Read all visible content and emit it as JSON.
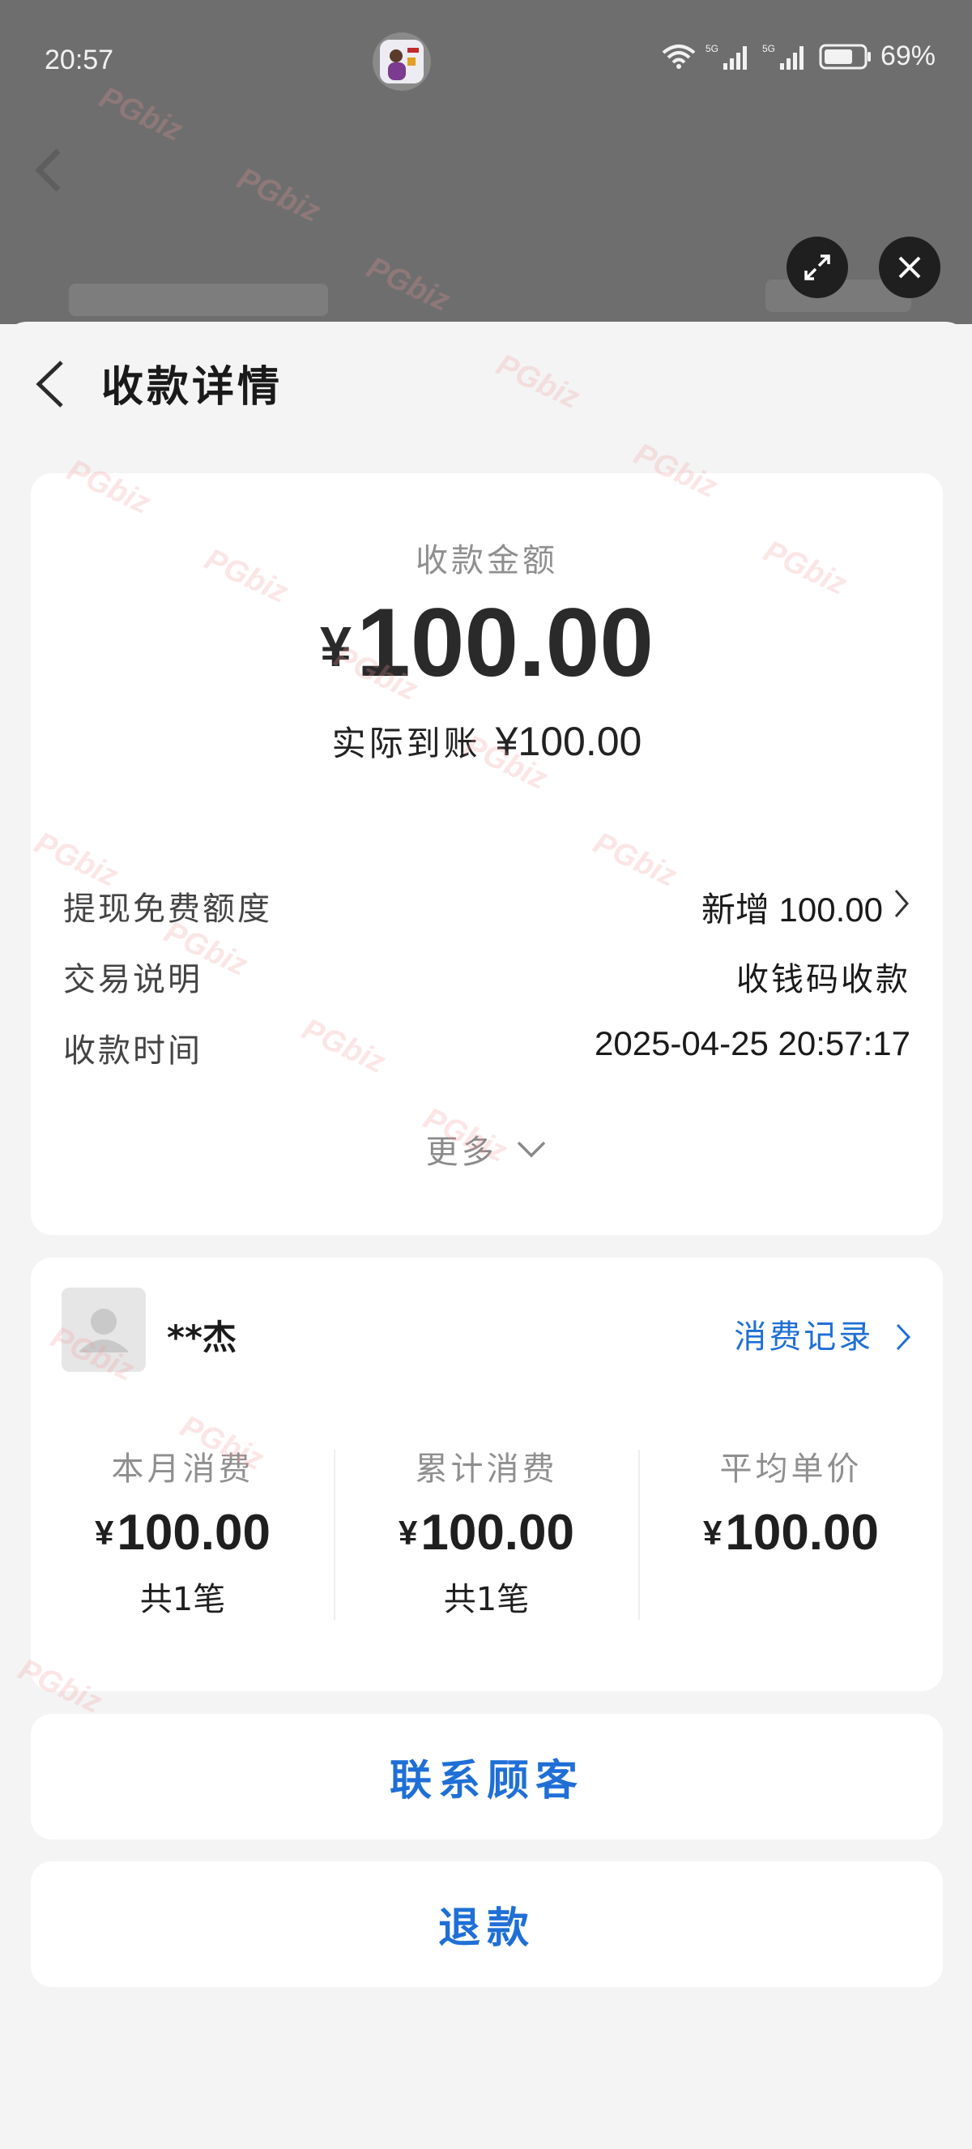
{
  "status": {
    "time": "20:57",
    "battery": "69%",
    "net1": "5G",
    "net2": "5G"
  },
  "header": {
    "title": "收款详情"
  },
  "payment": {
    "amount_label": "收款金额",
    "currency": "¥",
    "amount": "100.00",
    "actual_label": "实际到账",
    "actual_value": "¥100.00"
  },
  "details": [
    {
      "key": "提现免费额度",
      "value": "新增 100.00"
    },
    {
      "key": "交易说明",
      "value": "收钱码收款"
    },
    {
      "key": "收款时间",
      "value": "2025-04-25 20:57:17"
    }
  ],
  "more_label": "更多",
  "customer": {
    "name": "**杰",
    "record_link": "消费记录",
    "stats": [
      {
        "title": "本月消费",
        "currency": "¥",
        "value": "100.00",
        "count": "共1笔"
      },
      {
        "title": "累计消费",
        "currency": "¥",
        "value": "100.00",
        "count": "共1笔"
      },
      {
        "title": "平均单价",
        "currency": "¥",
        "value": "100.00",
        "count": ""
      }
    ]
  },
  "actions": {
    "contact": "联系顾客",
    "refund": "退款"
  },
  "watermark": "PGbiz",
  "colors": {
    "accent": "#1f6fd6",
    "background": "#f4f4f4",
    "card": "#ffffff"
  }
}
